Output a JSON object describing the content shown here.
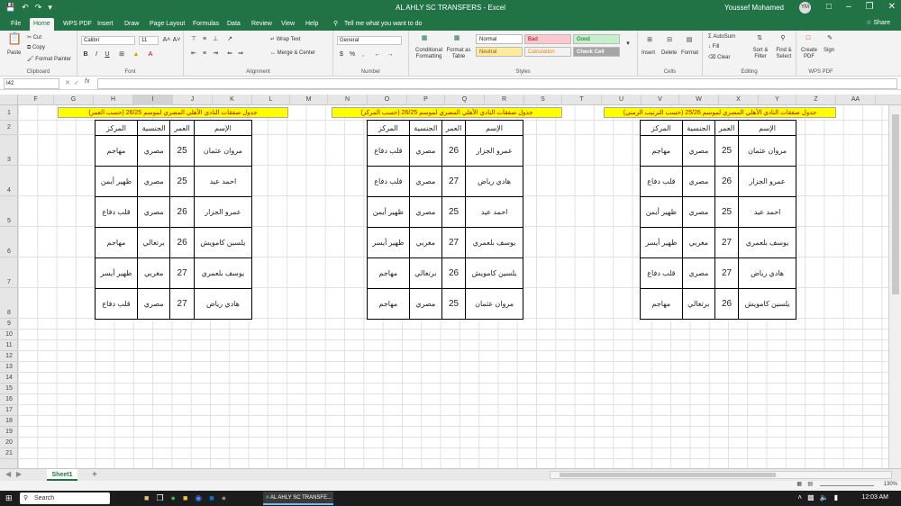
{
  "window": {
    "title": "AL AHLY SC TRANSFERS  -  Excel",
    "user": "Youssef Mohamed",
    "avatar_initials": "YM"
  },
  "tabs": [
    "File",
    "Home",
    "WPS PDF",
    "Insert",
    "Draw",
    "Page Layout",
    "Formulas",
    "Data",
    "Review",
    "View",
    "Help"
  ],
  "tell_me": "Tell me what you want to do",
  "share": "Share",
  "ribbon": {
    "clipboard": {
      "paste": "Paste",
      "cut": "Cut",
      "copy": "Copy",
      "format_painter": "Format Painter",
      "label": "Clipboard"
    },
    "font": {
      "name": "Calibri",
      "size": "11",
      "label": "Font"
    },
    "alignment": {
      "wrap": "Wrap Text",
      "merge": "Merge & Center",
      "label": "Alignment"
    },
    "number": {
      "format": "General",
      "label": "Number"
    },
    "styles": {
      "conditional": "Conditional Formatting",
      "format_table": "Format as Table",
      "normal": "Normal",
      "bad": "Bad",
      "good": "Good",
      "neutral": "Neutral",
      "calculation": "Calculation",
      "check_cell": "Check Cell",
      "label": "Styles"
    },
    "cells": {
      "insert": "Insert",
      "delete": "Delete",
      "format": "Format",
      "label": "Cells"
    },
    "editing": {
      "autosum": "AutoSum",
      "fill": "Fill",
      "clear": "Clear",
      "sort": "Sort & Filter",
      "find": "Find & Select",
      "label": "Editing"
    },
    "wps": {
      "create": "Create PDF",
      "sign": "Sign",
      "label": "WPS PDF"
    }
  },
  "name_box": "I42",
  "fx": "fx",
  "columns": [
    "F",
    "G",
    "H",
    "I",
    "J",
    "K",
    "L",
    "M",
    "N",
    "O",
    "P",
    "Q",
    "R",
    "S",
    "T",
    "U",
    "V",
    "W",
    "X",
    "Y",
    "Z",
    "AA"
  ],
  "rows": [
    "1",
    "2",
    "3",
    "4",
    "5",
    "6",
    "7",
    "8",
    "9",
    "10",
    "11",
    "12",
    "13",
    "14",
    "15",
    "16",
    "17",
    "18",
    "19",
    "20",
    "21"
  ],
  "headers": [
    "الإسم",
    "العمر",
    "الجنسية",
    "المركز"
  ],
  "tables": [
    {
      "title": "جدول صفقات النادي الأهلي المصري لموسم 26/25 (حسب العمر)",
      "rows": [
        {
          "name": "مروان عثمان",
          "age": "25",
          "nat": "مصري",
          "pos": "مهاجم"
        },
        {
          "name": "احمد عيد",
          "age": "25",
          "nat": "مصري",
          "pos": "ظهير أيمن"
        },
        {
          "name": "عمرو الجزار",
          "age": "26",
          "nat": "مصري",
          "pos": "قلب دفاع"
        },
        {
          "name": "يلسين كامويش",
          "age": "26",
          "nat": "برتغالي",
          "pos": "مهاجم"
        },
        {
          "name": "يوسف بلعمري",
          "age": "27",
          "nat": "مغربي",
          "pos": "ظهير أيسر"
        },
        {
          "name": "هادي رياض",
          "age": "27",
          "nat": "مصري",
          "pos": "قلب دفاع"
        }
      ]
    },
    {
      "title": "جدول صفقات النادي الأهلي المصري لموسم 26/25 (حسب المركز)",
      "rows": [
        {
          "name": "عمرو الجزار",
          "age": "26",
          "nat": "مصري",
          "pos": "قلب دفاع"
        },
        {
          "name": "هادي رياض",
          "age": "27",
          "nat": "مصري",
          "pos": "قلب دفاع"
        },
        {
          "name": "احمد عيد",
          "age": "25",
          "nat": "مصري",
          "pos": "ظهير أيمن"
        },
        {
          "name": "يوسف بلعمري",
          "age": "27",
          "nat": "مغربي",
          "pos": "ظهير أيسر"
        },
        {
          "name": "يلسين كامويش",
          "age": "26",
          "nat": "برتغالي",
          "pos": "مهاجم"
        },
        {
          "name": "مروان عثمان",
          "age": "25",
          "nat": "مصري",
          "pos": "مهاجم"
        }
      ]
    },
    {
      "title": "جدول صفقات النادي الأهلي المصري لموسم 25/26 (حسب الترتيب الزمني)",
      "rows": [
        {
          "name": "مروان عثمان",
          "age": "25",
          "nat": "مصري",
          "pos": "مهاجم"
        },
        {
          "name": "عمرو الجزار",
          "age": "26",
          "nat": "مصري",
          "pos": "قلب دفاع"
        },
        {
          "name": "احمد عيد",
          "age": "25",
          "nat": "مصري",
          "pos": "ظهير أيمن"
        },
        {
          "name": "يوسف بلعمري",
          "age": "27",
          "nat": "مغربي",
          "pos": "ظهير أيسر"
        },
        {
          "name": "هادي رياض",
          "age": "27",
          "nat": "مصري",
          "pos": "قلب دفاع"
        },
        {
          "name": "يلسين كامويش",
          "age": "26",
          "nat": "برتغالي",
          "pos": "مهاجم"
        }
      ]
    }
  ],
  "sheet": {
    "name": "Sheet1",
    "add": "+"
  },
  "status": {
    "zoom": "130%"
  },
  "taskbar": {
    "search": "Search",
    "excel_window": "AL AHLY SC TRANSFE...",
    "time": "12:03 AM"
  },
  "colors": {
    "excel_green": "#217346",
    "title_fill": "#ffff00",
    "title_text": "#c00000"
  }
}
